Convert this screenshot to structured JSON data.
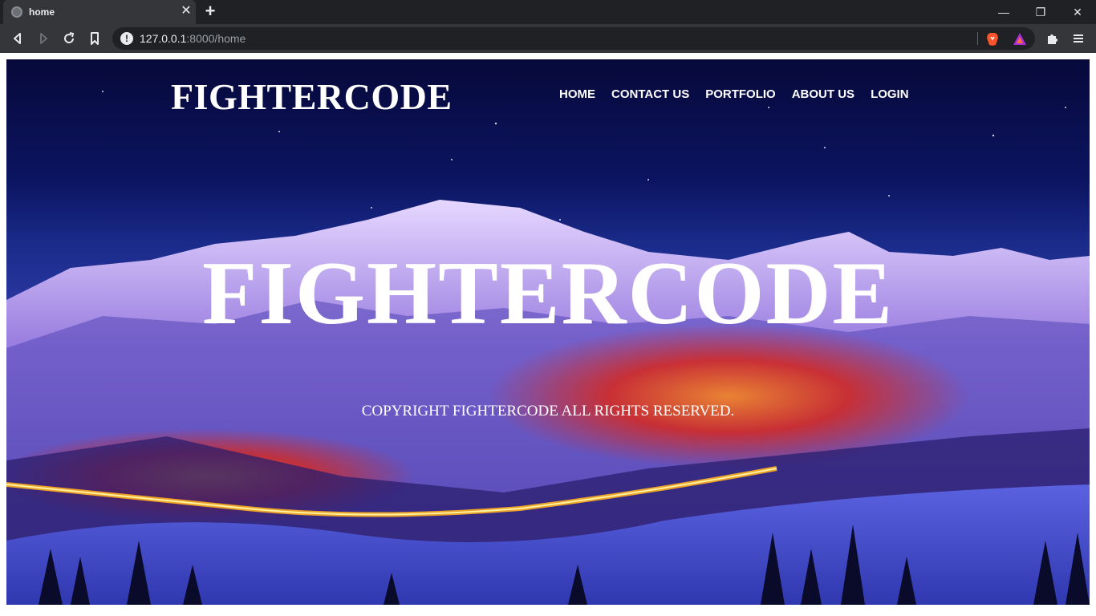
{
  "browser": {
    "tab_title": "home",
    "tab_close": "✕",
    "new_tab": "+",
    "url_host": "127.0.0.1",
    "url_rest": ":8000/home",
    "window_controls": {
      "minimize": "—",
      "restore": "❐",
      "close": "✕"
    }
  },
  "page": {
    "brand": "FIGHTERCODE",
    "nav": [
      "HOME",
      "CONTACT US",
      "PORTFOLIO",
      "ABOUT US",
      "LOGIN"
    ],
    "hero_title": "FIGHTERCODE",
    "copyright": "COPYRIGHT FIGHTERCODE ALL RIGHTS RESERVED."
  },
  "icons": {
    "back": "back-arrow-icon",
    "forward": "forward-arrow-icon",
    "reload": "reload-icon",
    "bookmark": "bookmark-icon",
    "site_info": "info-icon",
    "brave": "brave-lion-icon",
    "rewards": "brave-rewards-icon",
    "extensions": "puzzle-icon",
    "menu": "hamburger-menu-icon"
  },
  "colors": {
    "chrome_dark": "#202124",
    "chrome_toolbar": "#35363a",
    "sky_top": "#07093a",
    "snow_blue": "#3b3fb5",
    "glow_orange": "#ff6a00"
  }
}
